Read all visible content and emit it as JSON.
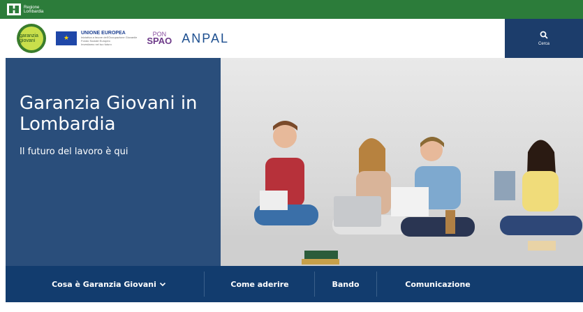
{
  "topbar": {
    "brand_line1": "Regione",
    "brand_line2": "Lombardia"
  },
  "header": {
    "logo_gg_text": "garanzia giovani",
    "ue_title": "UNIONE EUROPEA",
    "ue_sub1": "Iniziativa a favore dell'Occupazione Giovanile",
    "ue_sub2": "Fondo Sociale Europeo",
    "ue_sub3": "Investiamo nel tuo futuro",
    "spao_pon": "PON",
    "spao_main": "SPAO",
    "anpal": "ANPAL",
    "search_label": "Cerca"
  },
  "hero": {
    "title": "Garanzia Giovani in Lombardia",
    "subtitle": "Il futuro del lavoro è qui"
  },
  "nav": {
    "items": [
      {
        "label": "Cosa è Garanzia Giovani"
      },
      {
        "label": "Come aderire"
      },
      {
        "label": "Bando"
      },
      {
        "label": "Comunicazione"
      }
    ]
  },
  "colors": {
    "topbar": "#2c7c3a",
    "hero_panel": "#2a4e7b",
    "nav": "#123c6e",
    "search": "#1c3d6b"
  },
  "icons": [
    "regione-lombardia-logo",
    "eu-flag-icon",
    "search-icon",
    "chevron-down-icon"
  ]
}
